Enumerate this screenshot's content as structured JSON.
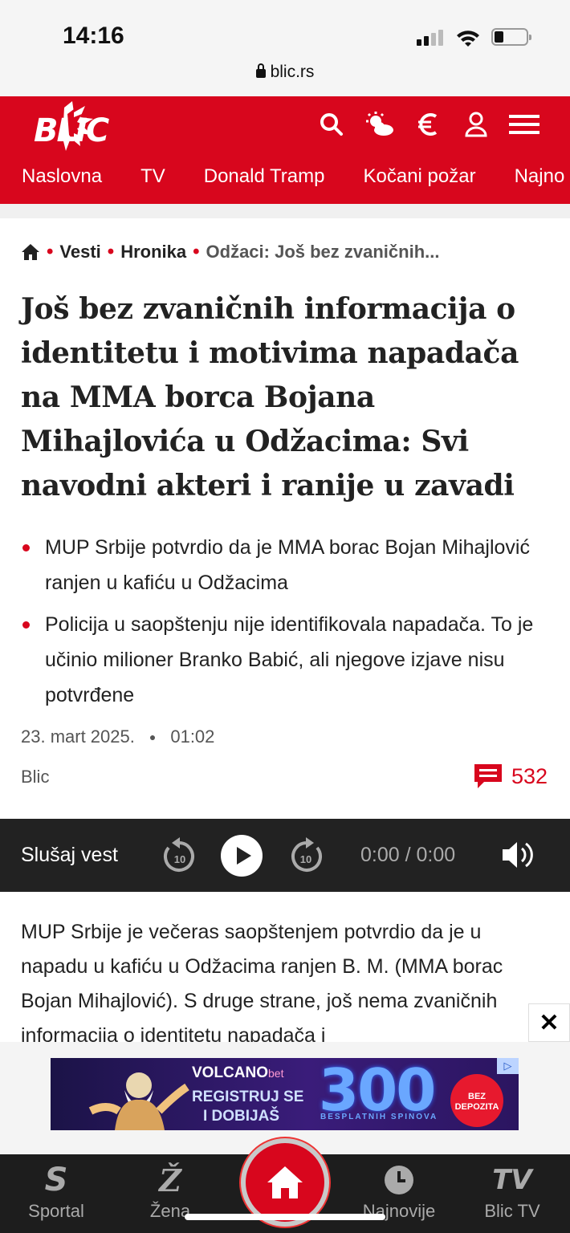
{
  "status_bar": {
    "time": "14:16",
    "url": "blic.rs"
  },
  "header": {
    "logo_text": "BLIC",
    "nav": [
      "Naslovna",
      "TV",
      "Donald Tramp",
      "Kočani požar",
      "Najno"
    ]
  },
  "breadcrumb": [
    "Vesti",
    "Hronika",
    "Odžaci: Još bez zvaničnih..."
  ],
  "article": {
    "title": "Još bez zvaničnih informacija o identitetu i motivima napadača na MMA borca Bojana Mihajlovića u Odžacima: Svi navodni akteri i ranije u zavadi",
    "bullets": [
      "MUP Srbije potvrdio da je MMA borac Bojan Mihajlović ranjen u kafiću u Odžacima",
      "Policija u saopštenju nije identifikovala napadača. To je učinio milioner Branko Babić, ali njegove izjave nisu potvrđene"
    ],
    "date": "23. mart 2025.",
    "time": "01:02",
    "source": "Blic",
    "comments_count": "532",
    "body": "MUP Srbije je večeras saopštenjem potvrdio da je u napadu u kafiću u Odžacima ranjen B. M. (MMA borac Bojan Mihajlović). S druge strane, još nema zvaničnih informacija o identitetu napadača i"
  },
  "player": {
    "label": "Slušaj vest",
    "rewind": "10",
    "forward": "10",
    "time": "0:00 / 0:00"
  },
  "ad": {
    "close": "✕",
    "brand": "VOLCANO",
    "brand_suffix": "bet",
    "line1": "REGISTRUJ SE",
    "line2": "I DOBIJAŠ",
    "big_number": "300",
    "sub": "BESPLATNIH SPINOVA",
    "badge": "BEZ DEPOZITA"
  },
  "bottom_nav": [
    {
      "label": "Sportal",
      "icon": "S"
    },
    {
      "label": "Žena",
      "icon": "Ž"
    },
    {
      "label": "Najnovije",
      "icon": "clock"
    },
    {
      "label": "Blic TV",
      "icon": "TV"
    }
  ],
  "colors": {
    "brand_red": "#d8061d",
    "dark": "#222222"
  }
}
